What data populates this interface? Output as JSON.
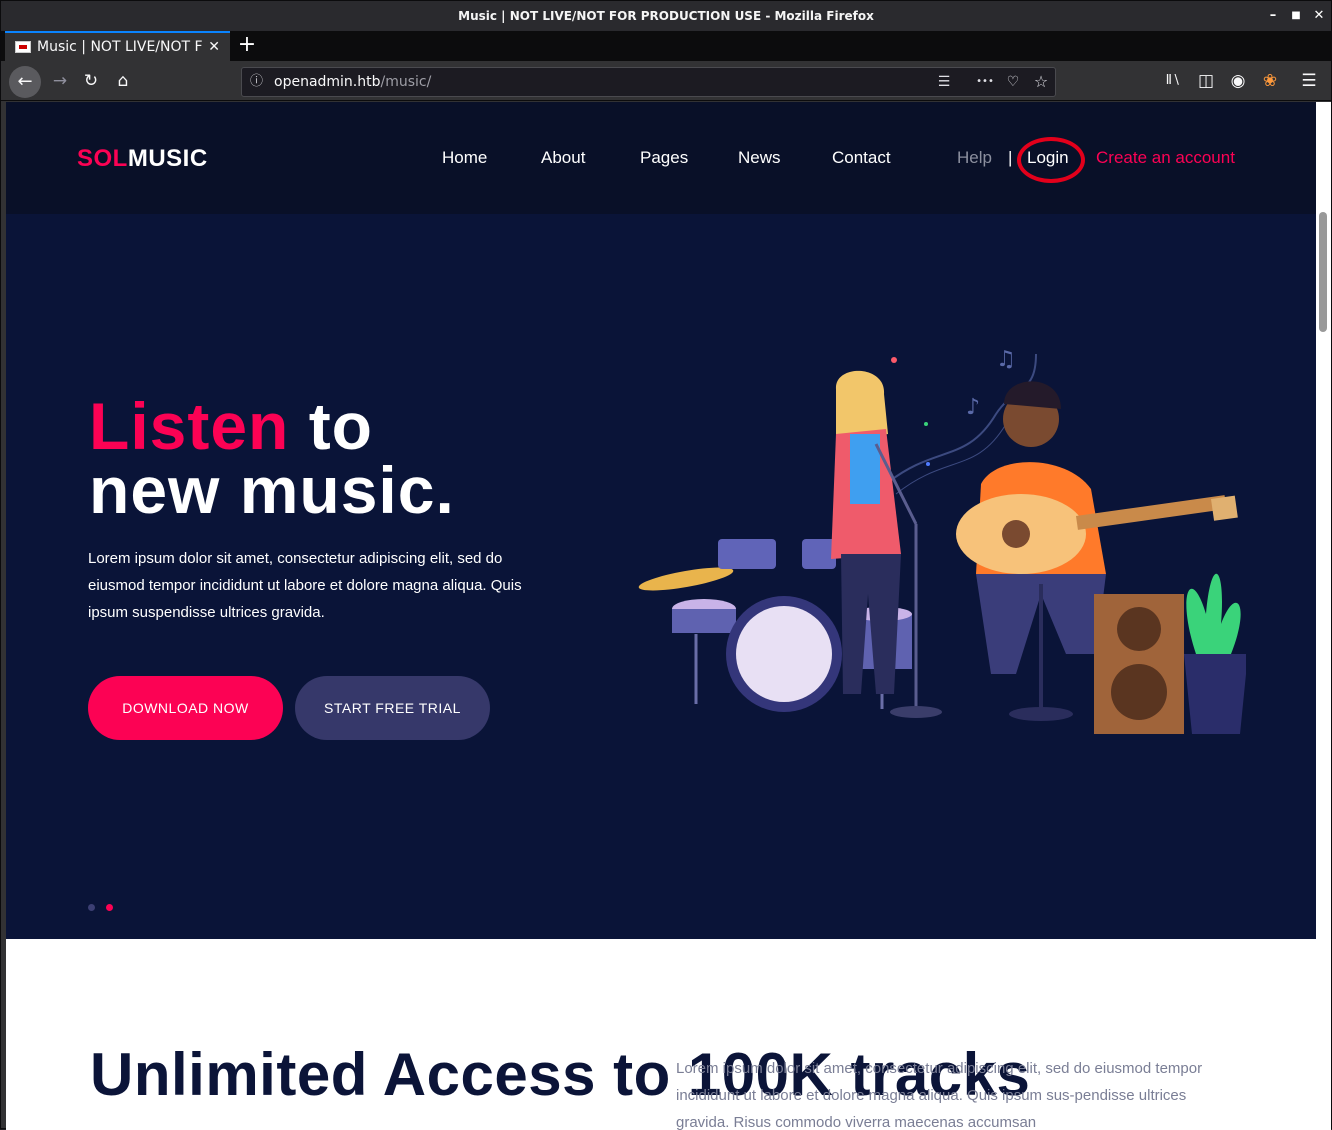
{
  "window": {
    "title": "Music | NOT LIVE/NOT FOR PRODUCTION USE - Mozilla Firefox",
    "minimize_glyph": "–",
    "maximize_glyph": "■",
    "close_glyph": "✕"
  },
  "tab": {
    "title": "Music | NOT LIVE/NOT FOR PRODUCTION USE",
    "close_glyph": "✕",
    "newtab_glyph": "+"
  },
  "toolbar": {
    "back_glyph": "←",
    "forward_glyph": "→",
    "reload_glyph": "↻",
    "home_glyph": "⌂",
    "info_glyph": "ⓘ",
    "url_host": "openadmin.htb",
    "url_path": "/music/",
    "reader_glyph": "☰",
    "more_glyph": "•••",
    "pocket_glyph": "♡",
    "star_glyph": "☆",
    "library_glyph": "Ⅱ∖",
    "sidebar_glyph": "◫",
    "account_glyph": "◉",
    "extension_glyph": "❀",
    "menu_glyph": "☰"
  },
  "site": {
    "logo_a": "SOL",
    "logo_b": "MUSIC",
    "nav": [
      "Home",
      "About",
      "Pages",
      "News",
      "Contact"
    ],
    "help": "Help",
    "separator": "|",
    "login": "Login",
    "create_account": "Create an account"
  },
  "hero": {
    "title_accent": "Listen",
    "title_rest_1": " to",
    "title_rest_2": "new music.",
    "lead": "Lorem ipsum dolor sit amet, consectetur adipiscing elit, sed do eiusmod tempor incididunt ut labore et dolore magna aliqua. Quis ipsum suspendisse ultrices gravida.",
    "btn_download": "DOWNLOAD NOW",
    "btn_trial": "START FREE TRIAL"
  },
  "section": {
    "title": "Unlimited Access to 100K tracks",
    "text": "Lorem ipsum dolor sit amet, consectetur adipiscing elit, sed do eiusmod tempor incididunt ut labore et dolore magna aliqua. Quis ipsum sus-pendisse ultrices gravida. Risus commodo viverra maecenas accumsan"
  },
  "colors": {
    "accent": "#fc0254",
    "hero_bg": "#0a1438",
    "secondary_button": "#36386a",
    "annotation_circle": "#e3001b"
  }
}
